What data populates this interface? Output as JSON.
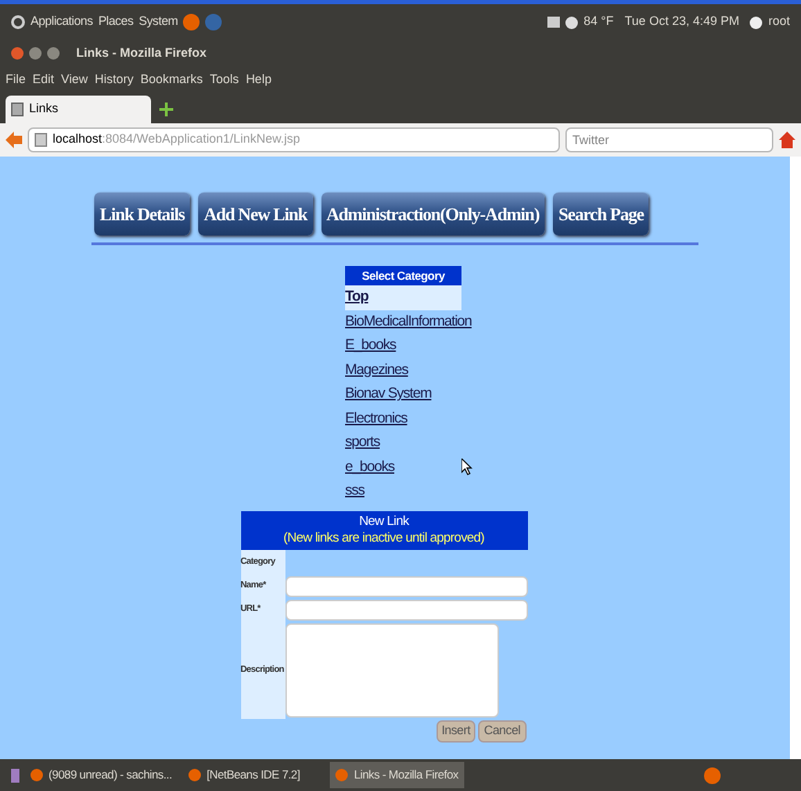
{
  "top_panel": {
    "menus": [
      "Applications",
      "Places",
      "System"
    ],
    "weather": "84 °F",
    "clock": "Tue Oct 23, 4:49 PM",
    "user": "root"
  },
  "window": {
    "title": "Links - Mozilla Firefox"
  },
  "menu_bar": [
    "File",
    "Edit",
    "View",
    "History",
    "Bookmarks",
    "Tools",
    "Help"
  ],
  "tabs": [
    {
      "label": "Links",
      "selected": true
    }
  ],
  "address_bar": {
    "host": "localhost",
    "path": ":8084/WebApplication1/LinkNew.jsp"
  },
  "search": {
    "placeholder": "Twitter"
  },
  "nav_buttons": [
    "Link Details",
    "Add New Link",
    "Administraction(Only-Admin)",
    "Search Page"
  ],
  "category_list": {
    "title": "Select Category",
    "items": [
      {
        "label": "Top",
        "selected": true
      },
      {
        "label": "BioMedicalInformation",
        "selected": false
      },
      {
        "label": "E_books",
        "selected": false
      },
      {
        "label": "Magezines",
        "selected": false
      },
      {
        "label": "Bionav System",
        "selected": false
      },
      {
        "label": "Electronics",
        "selected": false
      },
      {
        "label": "sports",
        "selected": false
      },
      {
        "label": "e_books",
        "selected": false
      },
      {
        "label": "sss",
        "selected": false
      }
    ]
  },
  "form": {
    "title": "New Link",
    "subtitle": "(New links are inactive until approved)",
    "fields": [
      {
        "label": "Category",
        "kind": "none"
      },
      {
        "label": "Name*",
        "kind": "text"
      },
      {
        "label": "URL*",
        "kind": "text"
      },
      {
        "label": "Description",
        "kind": "textarea"
      }
    ],
    "buttons": [
      "Insert",
      "Cancel"
    ]
  },
  "taskbar": [
    {
      "label": "(9089 unread) - sachins...",
      "selected": false
    },
    {
      "label": "[NetBeans IDE 7.2]",
      "selected": false
    },
    {
      "label": "Links - Mozilla Firefox",
      "selected": true
    }
  ]
}
